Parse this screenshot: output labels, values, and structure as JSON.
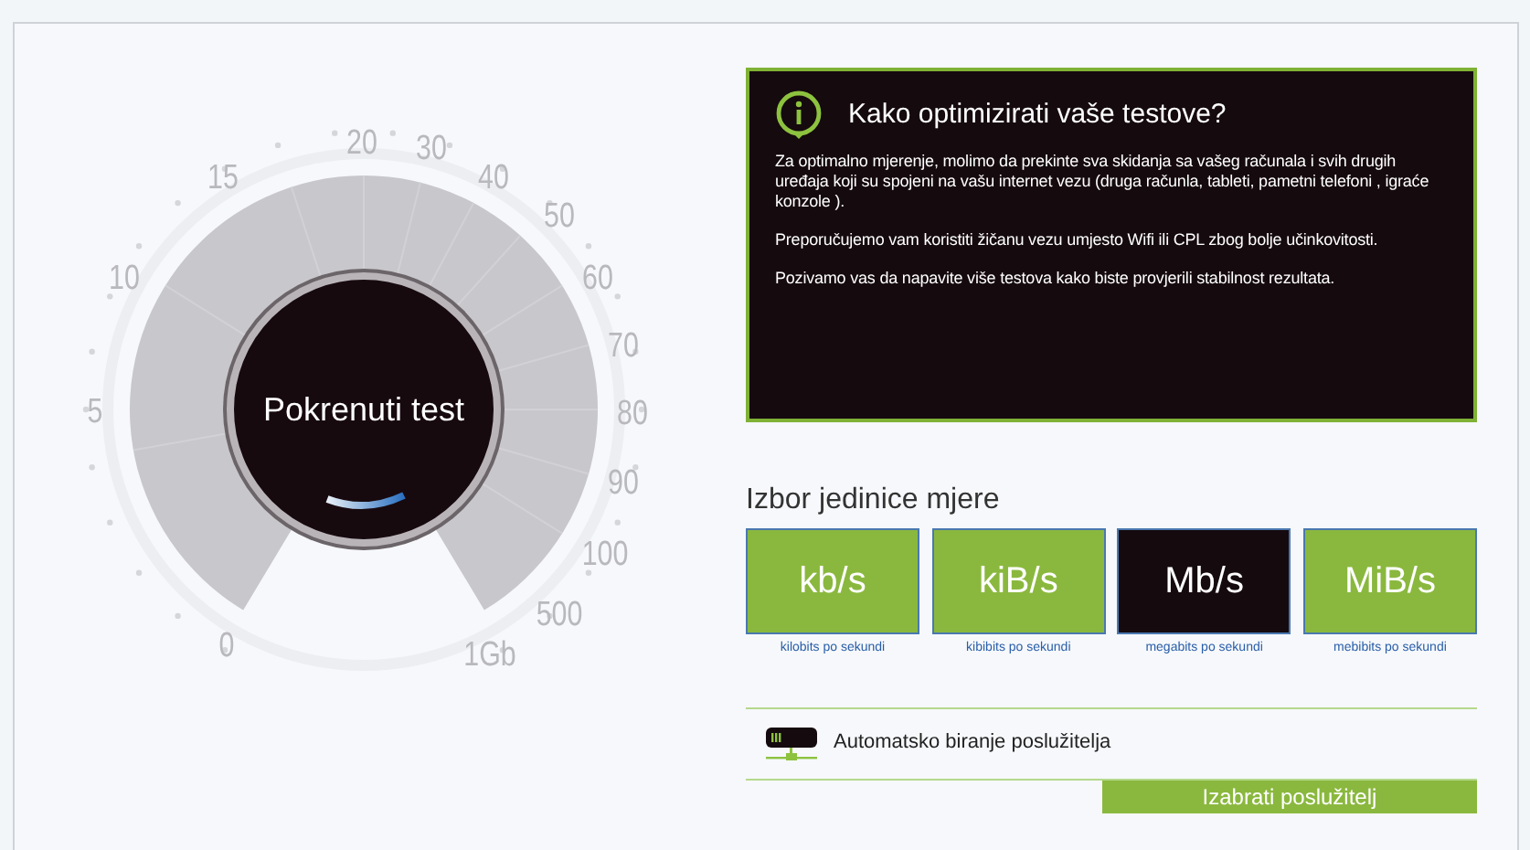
{
  "gauge": {
    "scale_labels": [
      "0",
      "5",
      "10",
      "15",
      "20",
      "30",
      "40",
      "50",
      "60",
      "70",
      "80",
      "90",
      "100",
      "500",
      "1Gb"
    ],
    "start_button": "Pokrenuti test"
  },
  "tips": {
    "title": "Kako optimizirati vaše testove?",
    "paragraphs": [
      "Za optimalno mjerenje, molimo da prekinte sva skidanja sa vašeg računala i svih drugih uređaja koji su spojeni na vašu internet vezu (druga računla, tableti, pametni telefoni , igraće konzole ).",
      "Preporučujemo vam koristiti žičanu vezu umjesto Wifi ili CPL zbog bolje učinkovitosti.",
      "Pozivamo vas da napavite više testova kako biste provjerili stabilnost rezultata."
    ]
  },
  "units": {
    "heading": "Izbor jedinice mjere",
    "options": [
      {
        "label": "kb/s",
        "caption": "kilobits po sekundi",
        "selected": false
      },
      {
        "label": "kiB/s",
        "caption": "kibibits po sekundi",
        "selected": false
      },
      {
        "label": "Mb/s",
        "caption": "megabits po sekundi",
        "selected": true
      },
      {
        "label": "MiB/s",
        "caption": "mebibits po sekundi",
        "selected": false
      }
    ]
  },
  "server": {
    "label": "Automatsko biranje poslužitelja",
    "button": "Izabrati poslužitelj"
  }
}
